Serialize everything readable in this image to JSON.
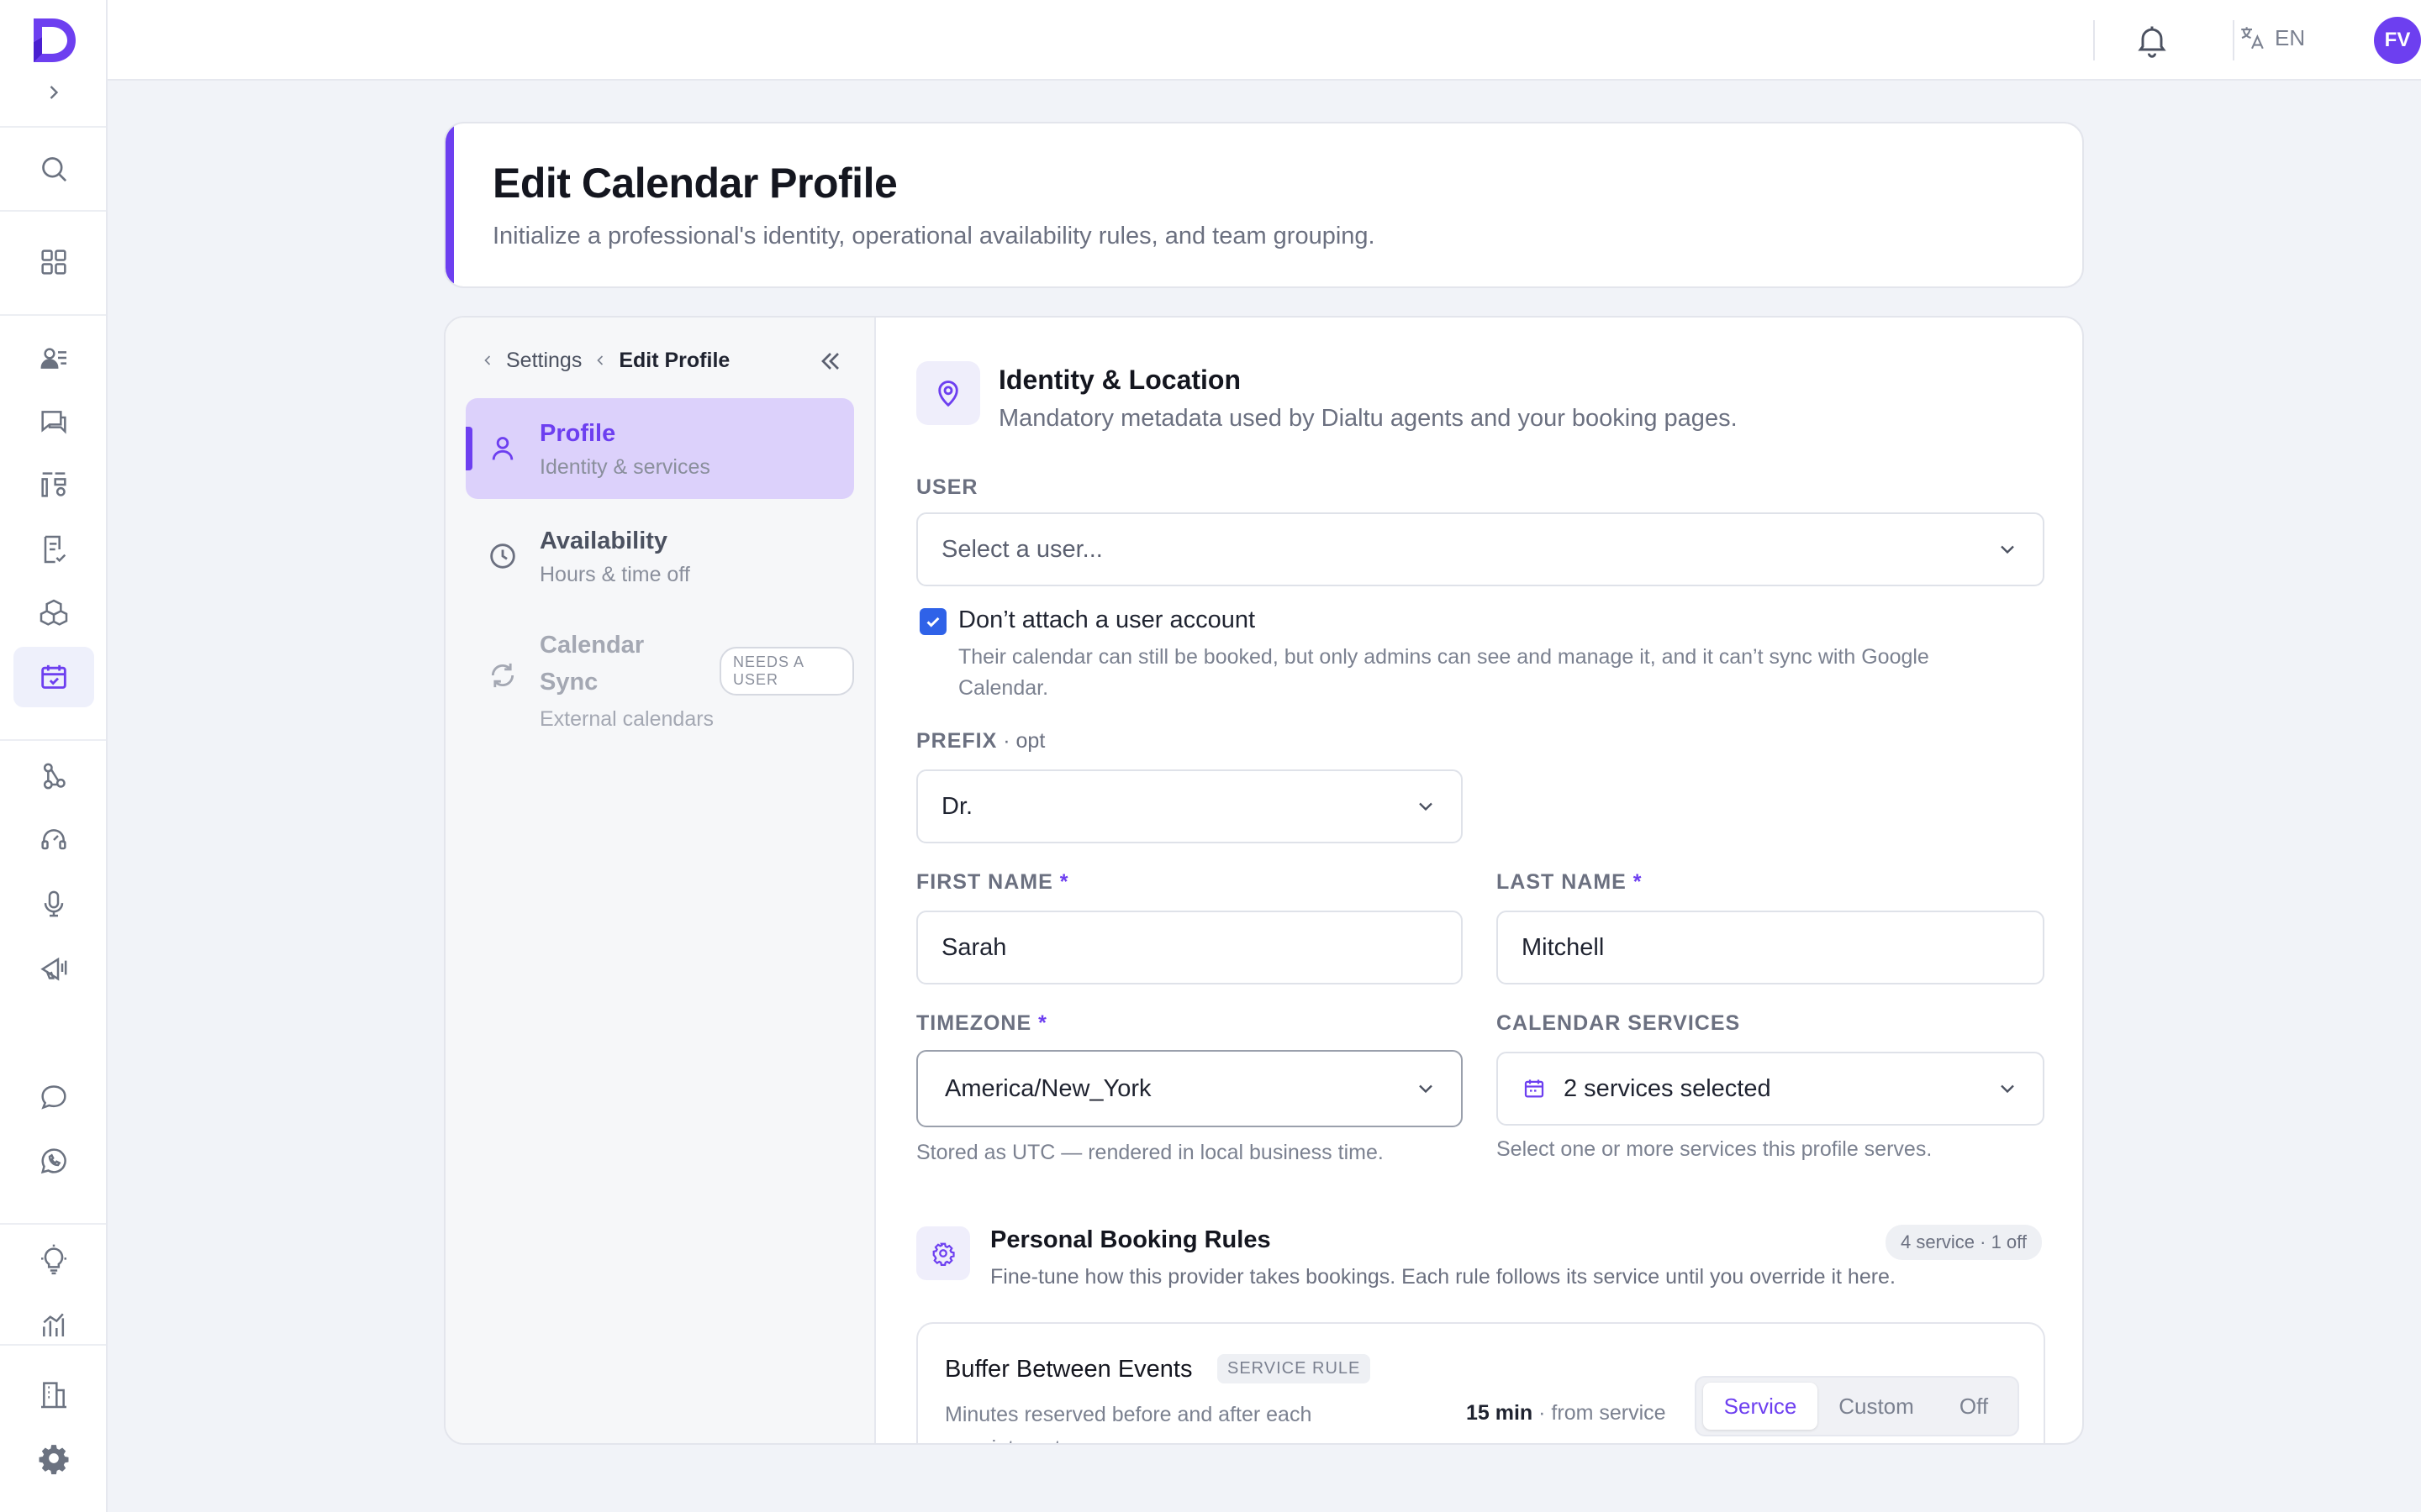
{
  "topbar": {
    "language": "EN",
    "user_initials": "FV"
  },
  "header": {
    "title": "Edit Calendar Profile",
    "subtitle": "Initialize a professional's identity, operational availability rules, and team grouping."
  },
  "breadcrumb": {
    "parent": "Settings",
    "current": "Edit Profile"
  },
  "subnav": {
    "items": [
      {
        "title": "Profile",
        "subtitle": "Identity & services"
      },
      {
        "title": "Availability",
        "subtitle": "Hours & time off"
      },
      {
        "title_line1": "Calendar",
        "title_line2": "Sync",
        "subtitle": "External calendars",
        "badge": "NEEDS A USER"
      }
    ]
  },
  "identity": {
    "title": "Identity & Location",
    "subtitle": "Mandatory metadata used by Dialtu agents and your booking pages.",
    "user_label": "USER",
    "user_placeholder": "Select a user...",
    "no_user_checkbox_label": "Don’t attach a user account",
    "no_user_checkbox_checked": true,
    "no_user_help": "Their calendar can still be booked, but only admins can see and manage it, and it can’t sync with Google Calendar.",
    "prefix_label": "PREFIX",
    "prefix_opt": " · opt",
    "prefix_value": "Dr.",
    "first_name_label": "FIRST NAME",
    "first_name_value": "Sarah",
    "last_name_label": "LAST NAME",
    "last_name_value": "Mitchell",
    "required_mark": "*",
    "timezone_label": "TIMEZONE",
    "timezone_value": "America/New_York",
    "timezone_help": "Stored as UTC — rendered in local business time.",
    "services_label": "CALENDAR SERVICES",
    "services_value": "2 services selected",
    "services_help": "Select one or more services this profile serves."
  },
  "booking_rules": {
    "title": "Personal Booking Rules",
    "subtitle": "Fine-tune how this provider takes bookings. Each rule follows its service until you override it here.",
    "summary_pill": "4 service · 1 off",
    "rules": [
      {
        "title": "Buffer Between Events",
        "tag": "SERVICE RULE",
        "description": "Minutes reserved before and after each appointment.",
        "value": "15 min",
        "value_source": " · from service",
        "options": [
          "Service",
          "Custom",
          "Off"
        ],
        "selected": "Service"
      }
    ]
  },
  "colors": {
    "accent": "#6d3ff0",
    "checkbox": "#2f62e8",
    "active_nav_bg": "#dcd1fb"
  }
}
